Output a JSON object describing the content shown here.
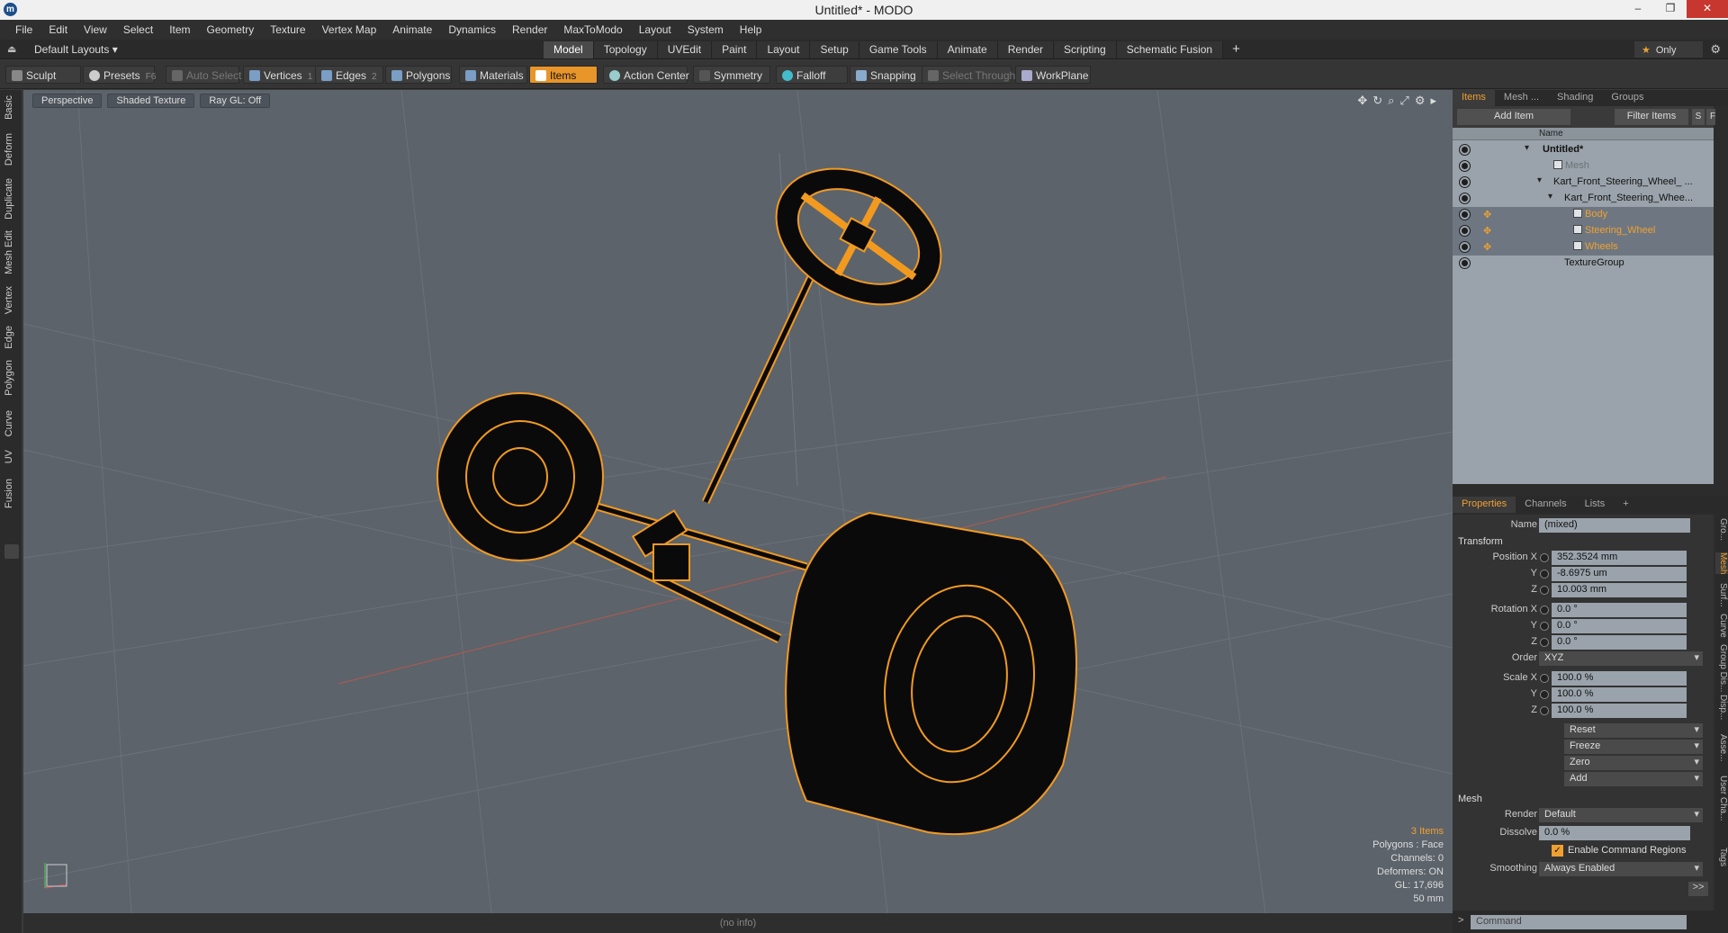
{
  "window": {
    "title": "Untitled* - MODO",
    "app_icon": "modo-logo-icon",
    "minimize": "–",
    "restore": "❐",
    "close": "✕"
  },
  "menu": [
    "File",
    "Edit",
    "View",
    "Select",
    "Item",
    "Geometry",
    "Texture",
    "Vertex Map",
    "Animate",
    "Dynamics",
    "Render",
    "MaxToModo",
    "Layout",
    "System",
    "Help"
  ],
  "layoutbar": {
    "layouts_label": "Default Layouts ▾",
    "tabs": [
      "Model",
      "Topology",
      "UVEdit",
      "Paint",
      "Layout",
      "Setup",
      "Game Tools",
      "Animate",
      "Render",
      "Scripting",
      "Schematic Fusion"
    ],
    "active_tab": "Model",
    "add_tab": "+",
    "only_label": "Only",
    "only_star": "★",
    "gear": "⚙"
  },
  "toolbar": {
    "sculpt": "Sculpt",
    "presets": "Presets",
    "presets_key": "F6",
    "auto_select": "Auto Select",
    "vertices": "Vertices",
    "vertices_count": "1",
    "edges": "Edges",
    "edges_count": "2",
    "polygons": "Polygons",
    "materials": "Materials",
    "items": "Items",
    "action_center": "Action Center",
    "symmetry": "Symmetry",
    "falloff": "Falloff",
    "snapping": "Snapping",
    "select_through": "Select Through",
    "workplane": "WorkPlane"
  },
  "left_tabs": [
    "Basic",
    "Deform",
    "Duplicate",
    "Mesh Edit",
    "Vertex",
    "Edge",
    "Polygon",
    "Curve",
    "UV",
    "Fusion"
  ],
  "viewport": {
    "view": "Perspective",
    "shading": "Shaded Texture",
    "raygl": "Ray GL: Off",
    "info": {
      "items": "3 Items",
      "polygons": "Polygons : Face",
      "channels": "Channels: 0",
      "deformers": "Deformers: ON",
      "gl": "GL: 17,696",
      "unit": "50 mm"
    },
    "status": "(no info)"
  },
  "items_panel": {
    "tabs": [
      "Items",
      "Mesh ...",
      "Shading",
      "Groups"
    ],
    "active_tab": "Items",
    "add_item": "Add Item",
    "filter_items": "Filter Items",
    "s_button": "S",
    "f_button": "F",
    "column_name": "Name",
    "rows": [
      {
        "label": "Untitled*",
        "style": "bold"
      },
      {
        "label": "Mesh",
        "style": "dim"
      },
      {
        "label": "Kart_Front_Steering_Wheel_ ...",
        "style": "normal"
      },
      {
        "label": "Kart_Front_Steering_Whee...",
        "style": "normal"
      },
      {
        "label": "Body",
        "style": "orange"
      },
      {
        "label": "Steering_Wheel",
        "style": "orange"
      },
      {
        "label": "Wheels",
        "style": "orange"
      },
      {
        "label": "TextureGroup",
        "style": "normal"
      }
    ]
  },
  "props_panel": {
    "tabs": [
      "Properties",
      "Channels",
      "Lists",
      "+"
    ],
    "active_tab": "Properties",
    "name_label": "Name",
    "name_value": "(mixed)",
    "transform_title": "Transform",
    "position_label": "Position X",
    "position": [
      "352.3524 mm",
      "-8.6975 um",
      "10.003 mm"
    ],
    "rotation_label": "Rotation X",
    "rotation": [
      "0.0 °",
      "0.0 °",
      "0.0 °"
    ],
    "order_label": "Order",
    "order_value": "XYZ",
    "scale_label": "Scale X",
    "scale": [
      "100.0 %",
      "100.0 %",
      "100.0 %"
    ],
    "y_label": "Y",
    "z_label": "Z",
    "actions": [
      "Reset",
      "Freeze",
      "Zero",
      "Add"
    ],
    "mesh_title": "Mesh",
    "render_label": "Render",
    "render_value": "Default",
    "dissolve_label": "Dissolve",
    "dissolve_value": "0.0 %",
    "command_regions": "Enable Command Regions",
    "smoothing_label": "Smoothing",
    "smoothing_value": "Always Enabled",
    "more": ">>",
    "side_tabs": [
      "Gro...",
      "Mesh",
      "Surf...",
      "Curve",
      "Group Dis...",
      "Disp...",
      "Asse...",
      "User Cha...",
      "Tags"
    ]
  },
  "command": {
    "placeholder": "Command",
    "prompt": ">"
  },
  "colors": {
    "accent": "#f0a030",
    "viewport_bg": "#5c636b",
    "wire": "#f29a1f"
  }
}
